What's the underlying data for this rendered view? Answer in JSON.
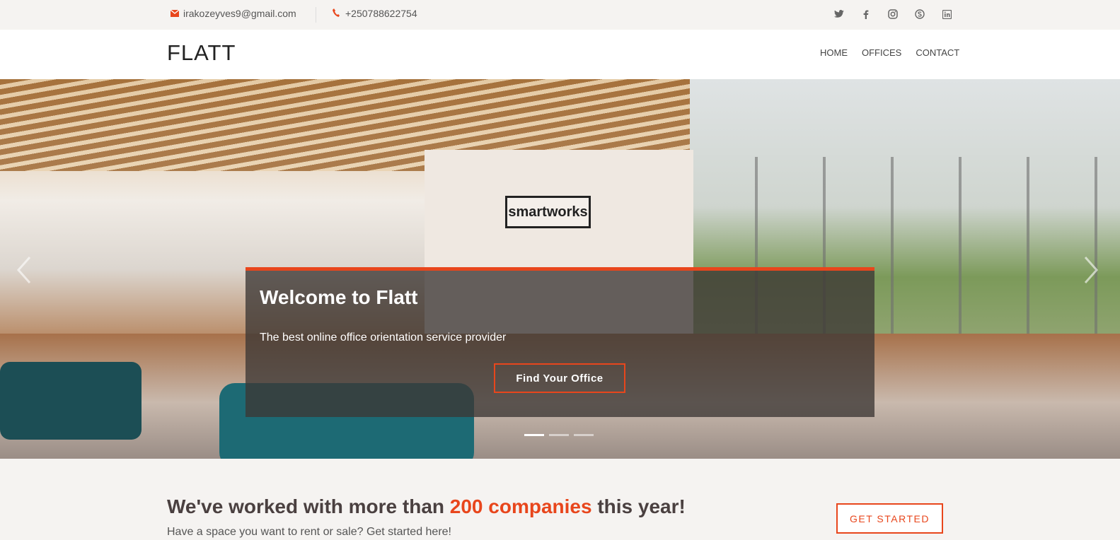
{
  "topbar": {
    "email": "irakozeyves9@gmail.com",
    "phone": "+250788622754",
    "social": [
      "twitter-icon",
      "facebook-icon",
      "instagram-icon",
      "skype-icon",
      "linkedin-icon"
    ]
  },
  "header": {
    "logo": "FLATT",
    "nav": [
      "HOME",
      "OFFICES",
      "CONTACT"
    ]
  },
  "hero": {
    "brand_sign": "smartworks",
    "caption_title": "Welcome to Flatt",
    "caption_text": "The best online office orientation service provider",
    "cta_label": "Find Your Office",
    "slides": 3,
    "active_slide": 1
  },
  "promo": {
    "headline_before": "We've worked with more than ",
    "headline_accent": "200 companies",
    "headline_after": " this year!",
    "subtext": "Have a space you want to rent or sale? Get started here!",
    "button_label": "GET STARTED"
  },
  "colors": {
    "accent": "#e8461c",
    "dark_text": "#4a4040"
  }
}
